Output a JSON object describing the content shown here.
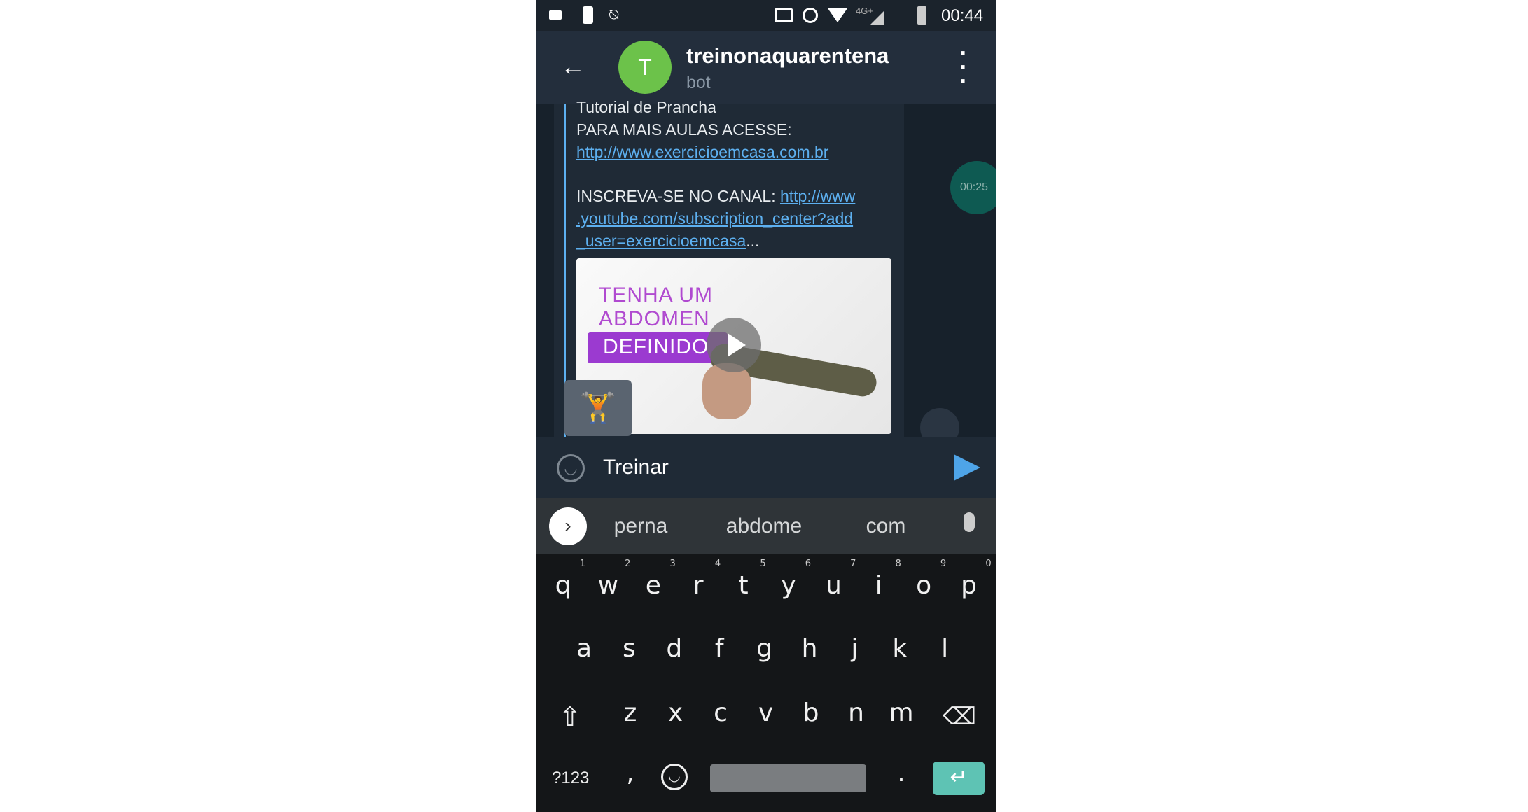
{
  "status_bar": {
    "time": "00:44",
    "network": "4G+",
    "icons": [
      "video-icon",
      "phone-sleep-icon",
      "notifications-off-icon",
      "cast-icon",
      "alarm-icon",
      "wifi-icon",
      "signal-icon",
      "battery-icon"
    ]
  },
  "header": {
    "title": "treinonaquarentena",
    "subtitle": "bot",
    "avatar_letter": "T",
    "avatar_color": "#6cc24a"
  },
  "message": {
    "lines": [
      "Tutorial de Prancha",
      "PARA MAIS AULAS ACESSE:"
    ],
    "link1": "http://www.exercicioemcasa.com.br",
    "subscribe_label": "INSCREVA-SE NO CANAL: ",
    "link2a": "http://www",
    "link2b": ".youtube.com/subscription_center?add",
    "link2c": "_user=exercicioemcasa",
    "ellipsis": "...",
    "preview": {
      "line1": "TENHA UM",
      "line2": "ABDOMEN",
      "line3": "DEFINIDO"
    },
    "emoji": "🏋"
  },
  "video_timer": "00:25",
  "input": {
    "value": "Treinar"
  },
  "suggestions": [
    "perna",
    "abdome",
    "com"
  ],
  "keyboard": {
    "row1": [
      {
        "k": "q",
        "n": "1"
      },
      {
        "k": "w",
        "n": "2"
      },
      {
        "k": "e",
        "n": "3"
      },
      {
        "k": "r",
        "n": "4"
      },
      {
        "k": "t",
        "n": "5"
      },
      {
        "k": "y",
        "n": "6"
      },
      {
        "k": "u",
        "n": "7"
      },
      {
        "k": "i",
        "n": "8"
      },
      {
        "k": "o",
        "n": "9"
      },
      {
        "k": "p",
        "n": "0"
      }
    ],
    "row2": [
      "a",
      "s",
      "d",
      "f",
      "g",
      "h",
      "j",
      "k",
      "l"
    ],
    "row3": [
      "z",
      "x",
      "c",
      "v",
      "b",
      "n",
      "m"
    ],
    "symbols": "?123",
    "comma": ",",
    "period": "."
  },
  "colors": {
    "accent": "#5db0f0",
    "enter": "#5ec3b4"
  }
}
